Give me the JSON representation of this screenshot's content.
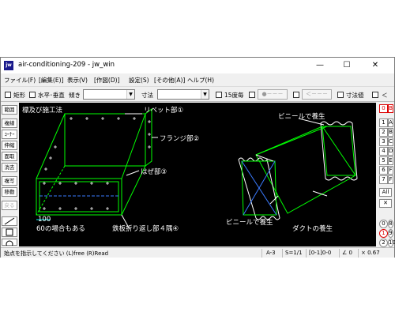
{
  "window": {
    "app_icon_text": "jw",
    "title": "air-conditioning-209 - jw_win",
    "controls": {
      "minimize": "—",
      "maximize": "☐",
      "close": "✕"
    }
  },
  "menu": [
    "ファイル(F)",
    "[編集(E)]",
    "表示(V)",
    "[作図(D)]",
    "設定(S)",
    "[その他(A)]",
    "ヘルプ(H)"
  ],
  "toolbar": {
    "rect_label": "矩形",
    "hv_label": "水平･垂直",
    "tilt_label": "傾き",
    "tilt_value": "",
    "dim_label": "寸法",
    "dim_value": "",
    "deg15_label": "15度毎",
    "btn1": "●－－－",
    "btn2": "＜－－－",
    "dimval_label": "寸法値",
    "lt_label": "＜"
  },
  "left_tools": [
    "範囲",
    "複線",
    "ｺｰﾅｰ",
    "伸縮",
    "面取",
    "消去",
    "複写",
    "移動",
    "戻る"
  ],
  "right_tools": {
    "row1": [
      "0",
      "B"
    ],
    "grid": [
      [
        "1",
        "A"
      ],
      [
        "2",
        "B"
      ],
      [
        "3",
        "C"
      ],
      [
        "4",
        "D"
      ],
      [
        "5",
        "E"
      ],
      [
        "6",
        "F"
      ],
      [
        "7",
        "F"
      ]
    ],
    "all": "All",
    "x": "✕",
    "bottom": [
      "0",
      "8",
      "1",
      "9",
      "2",
      "10"
    ]
  },
  "drawing": {
    "title": "標及び施工法",
    "label_rivet": "リベット部①",
    "label_flange": "フランジ部②",
    "label_seam": "はぜ部③",
    "label_fold": "鉄板折り返し部４隅④",
    "label_100": "100",
    "label_60": "60の場合もある",
    "label_vinyl_top": "ビニールで養生",
    "label_vinyl_bottom": "ビニールで養生",
    "label_duct": "ダクトの養生"
  },
  "status": {
    "message": "始点を指示してください (L)free (R)Read",
    "paper": "A-3",
    "scale": "S=1/1",
    "layer": "[0-1]0-0",
    "angle": "∠ 0",
    "zoom": "× 0.67"
  }
}
